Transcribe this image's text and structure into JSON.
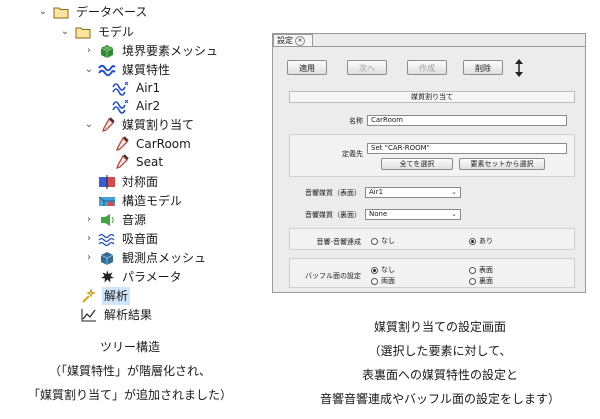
{
  "tree": {
    "database": "データベース",
    "model": "モデル",
    "boundary_mesh": "境界要素メッシュ",
    "media_props": "媒質特性",
    "air1": "Air1",
    "air2": "Air2",
    "media_assign": "媒質割り当て",
    "carroom": "CarRoom",
    "seat": "Seat",
    "symmetry": "対称面",
    "structure_model": "構造モデル",
    "sound_source": "音源",
    "absorbing_surface": "吸音面",
    "observation_mesh": "観測点メッシュ",
    "parameter": "パラメータ",
    "analysis": "解析",
    "analysis_result": "解析結果"
  },
  "dialog": {
    "tab_label": "設定",
    "toolbar": {
      "apply": "適用",
      "next": "次へ",
      "create": "作成",
      "delete": "削除"
    },
    "section_title": "媒質割り当て",
    "name_label": "名称",
    "name_value": "CarRoom",
    "definition_label": "定義先",
    "definition_value": "Set \"CAR-ROOM\"",
    "select_all": "全てを選択",
    "select_from_set": "要素セットから選択",
    "front_media_label": "音響媒質（表面）",
    "front_media_value": "Air1",
    "back_media_label": "音響媒質（裏面）",
    "back_media_value": "None",
    "coupling_label": "音響-音響連成",
    "coupling_none": "なし",
    "coupling_yes": "あり",
    "coupling_selected": "あり",
    "baffle_label": "バッフル面の設定",
    "baffle_none": "なし",
    "baffle_front": "表面",
    "baffle_both": "両面",
    "baffle_back": "裏面",
    "baffle_selected": "なし"
  },
  "captions": {
    "left": [
      "ツリー構造",
      "（「媒質特性」が階層化され、",
      "「媒質割り当て」が追加されました）"
    ],
    "right": [
      "媒質割り当ての設定画面",
      "（選択した要素に対して、",
      "表裏面への媒質特性の設定と",
      "音響音響連成やバッフル面の設定をします）"
    ]
  },
  "colors": {
    "folder": "#f2c230",
    "mesh": "#2e8b2e",
    "media": "#1f4fd8",
    "assign": "#c0392b",
    "selection": "#cfe6fb"
  }
}
